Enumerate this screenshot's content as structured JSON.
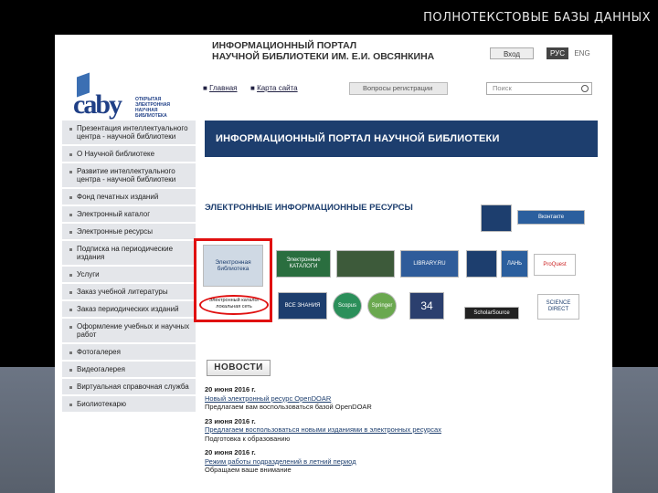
{
  "slide": {
    "title": "ПОЛНОТЕКСТОВЫЕ БАЗЫ ДАННЫХ"
  },
  "header": {
    "logo_text": "caby",
    "logo_subtitle": "ОТКРЫТАЯ ЭЛЕКТРОННАЯ НАУЧНАЯ БИБЛИОТЕКА",
    "portal_title_line1": "ИНФОРМАЦИОННЫЙ ПОРТАЛ",
    "portal_title_line2": "НАУЧНОЙ БИБЛИОТЕКИ ИМ. Е.И. ОВСЯНКИНА",
    "login_label": "Вход",
    "lang_ru": "РУС",
    "lang_en": "ENG"
  },
  "nav": {
    "home": "Главная",
    "sitemap": "Карта сайта",
    "ask_button": "Вопросы регистрации",
    "search_placeholder": "Поиск"
  },
  "sidebar": {
    "items": [
      "Презентация интеллектуального центра - научной библиотеки",
      "О Научной библиотеке",
      "Развитие интеллектуального центра - научной библиотеки",
      "Фонд печатных изданий",
      "Электронный каталог",
      "Электронные ресурсы",
      "Подписка на периодические издания",
      "Услуги",
      "Заказ учебной литературы",
      "Заказ периодических изданий",
      "Оформление учебных и научных работ",
      "Фотогалерея",
      "Видеогалерея",
      "Виртуальная справочная служба",
      "Биолиотекарю"
    ]
  },
  "main": {
    "banner": "ИНФОРМАЦИОННЫЙ ПОРТАЛ НАУЧНОЙ БИБЛИОТЕКИ",
    "section_title": "ЭЛЕКТРОННЫЕ ИНФОРМАЦИОННЫЕ РЕСУРСЫ",
    "tiles": {
      "e_library": "Электронная библиотека",
      "network_link": "Электронный каталог локальная сеть",
      "catalogs": "Электронные КАТАЛОГИ",
      "vse_znaniya": "ВСЕ ЗНАНИЯ",
      "elibrary": "LIBRARY.RU",
      "scopus": "Scopus",
      "springer": "Springer",
      "scholar": "ScholarSource",
      "proquest": "ProQuest",
      "vk": "Вконтакте",
      "tile_34": "34",
      "lanb": "ЛАНЬ",
      "sciencedirect": "SCIENCE DIRECT"
    },
    "news_title": "НОВОСТИ",
    "news": [
      {
        "date": "20 июня 2016 г.",
        "title": "Новый электронный ресурс OpenDOAR",
        "text": "Предлагаем вам воспользоваться базой OpenDOAR"
      },
      {
        "date": "23 июня 2016 г.",
        "title": "Предлагаем воспользоваться новыми изданиями в электронных ресурсах",
        "text": "Подготовка к образованию"
      },
      {
        "date": "20 июня 2016 г.",
        "title": "Режим работы подразделений в летний период",
        "text": "Обращаем ваше внимание"
      }
    ]
  }
}
